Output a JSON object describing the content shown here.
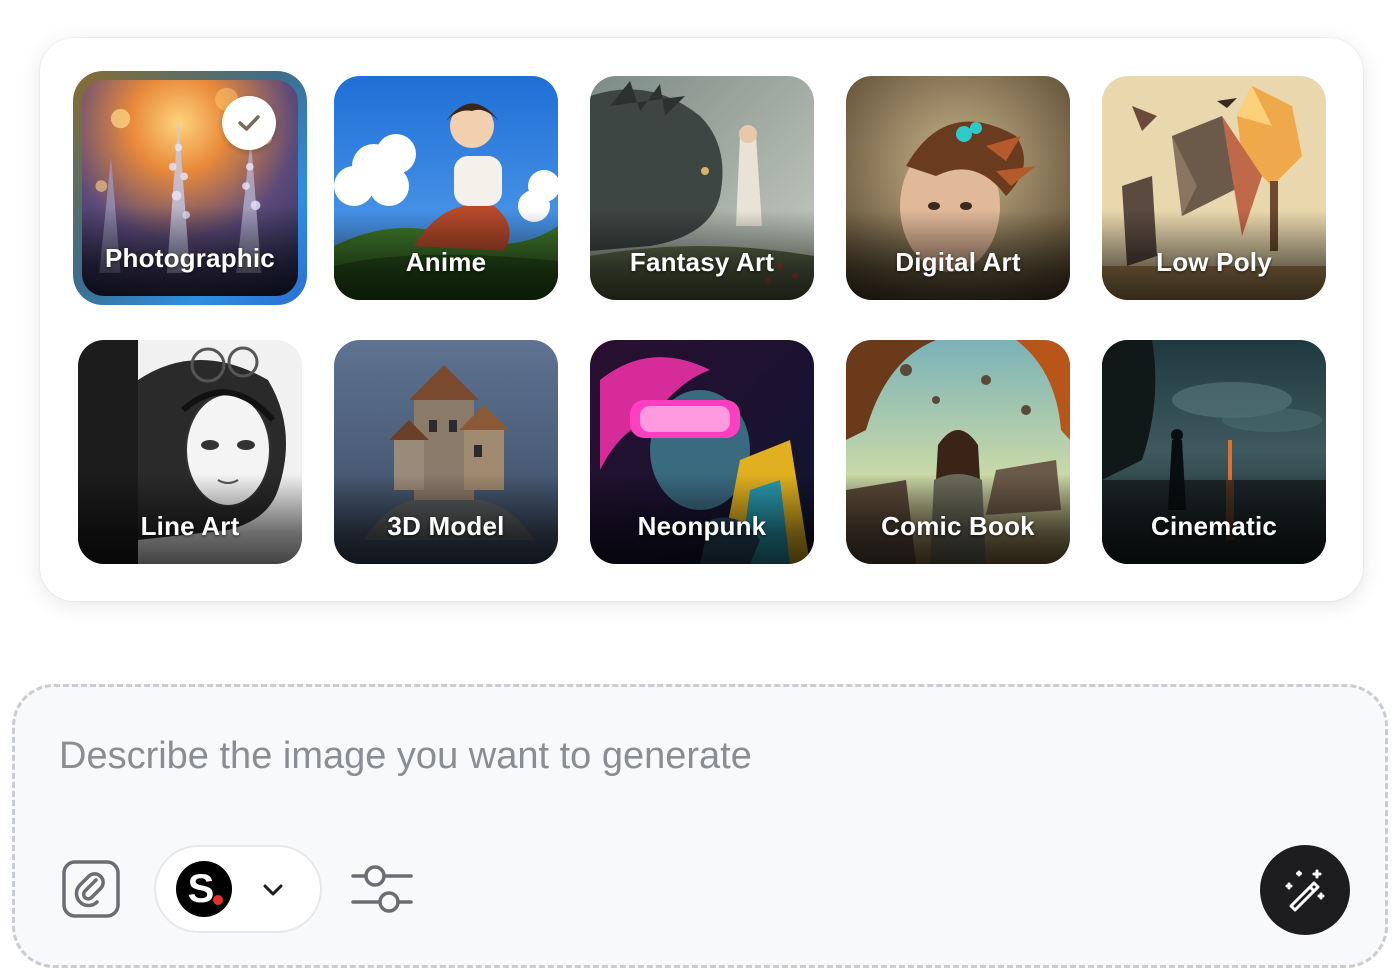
{
  "styles": [
    {
      "label": "Photographic",
      "selected": true
    },
    {
      "label": "Anime",
      "selected": false
    },
    {
      "label": "Fantasy Art",
      "selected": false
    },
    {
      "label": "Digital Art",
      "selected": false
    },
    {
      "label": "Low Poly",
      "selected": false
    },
    {
      "label": "Line Art",
      "selected": false
    },
    {
      "label": "3D Model",
      "selected": false
    },
    {
      "label": "Neonpunk",
      "selected": false
    },
    {
      "label": "Comic Book",
      "selected": false
    },
    {
      "label": "Cinematic",
      "selected": false
    }
  ],
  "composer": {
    "placeholder": "Describe the image you want to generate",
    "value": "",
    "model": {
      "letter": "S",
      "accent_color": "#e53030"
    }
  },
  "icons": {
    "selected_check": "check-icon",
    "attach": "attach-icon",
    "model_dropdown": "chevron-down-icon",
    "settings": "sliders-icon",
    "generate": "magic-wand-icon"
  },
  "colors": {
    "panel_bg": "#ffffff",
    "composer_bg": "#f8f9fb",
    "generate_button": "#1d1d1f",
    "selected_ring": "#2f8fe0"
  }
}
